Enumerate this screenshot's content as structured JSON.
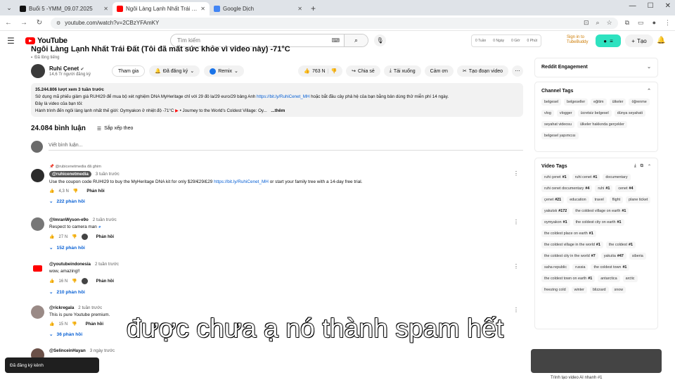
{
  "browser": {
    "tabs": [
      {
        "title": "Buổi 5 -YMM_09.07.2025",
        "favicon": "#111111"
      },
      {
        "title": "Ngôi Làng Lạnh Nhất Trái Đ...",
        "favicon": "#ff0000"
      },
      {
        "title": "Google Dịch",
        "favicon": "#4285f4"
      }
    ],
    "url": "youtube.com/watch?v=2CBzYFAmKY"
  },
  "header": {
    "logo": "YouTube",
    "search_placeholder": "Tìm kiếm",
    "extension": {
      "stats": [
        "0 Tuần",
        "0 Ngày",
        "0 Giờ",
        "0 Phút"
      ]
    },
    "tubebuddy": [
      "Sign in to",
      "TubeBuddy"
    ],
    "create_label": "Tạo"
  },
  "video": {
    "title": "Ngôi Làng Lạnh Nhất Trái Đất (Tôi đã mất sức khỏe vì video này) -71°C",
    "dubbed": "Đã lồng tiếng",
    "channel": {
      "name": "Ruhi Çenet",
      "subs": "14,6 Tr người đăng ký"
    },
    "buttons": {
      "join": "Tham gia",
      "subscribed": "Đã đăng ký",
      "remix": "Remix",
      "likes": "763 N",
      "share": "Chia sẻ",
      "download": "Tải xuống",
      "thanks": "Cảm ơn",
      "clip": "Tạo đoạn video"
    },
    "description": {
      "stats": "35.244.806 lượt xem  3 tuần trước",
      "line1": "Sử dụng mã phiếu giảm giá RUHI29 để mua bộ xét nghiệm DNA MyHeritage chỉ với 29 đô la/29 euro/29 bảng Anh",
      "link": "https://bit.ly/RuhiCenet_MH",
      "line1b": "hoặc bắt đầu cây phả hệ của bạn bằng bản dùng thử miễn phí 14 ngày.",
      "line2": "Đây là video của bạn tôi:",
      "line3": "Hành trình đến ngôi làng lạnh nhất thế giới: Oymyakon ở nhiệt độ -71°C",
      "line3b": "• Journey to the World's Coldest Village: Oy...",
      "more": "...thêm"
    }
  },
  "comments": {
    "count": "24.084 bình luận",
    "sort": "Sắp xếp theo",
    "placeholder": "Viết bình luận...",
    "items": [
      {
        "pinned": "@rubicenetmedia đã ghim",
        "author": "@ruhicenetmedia",
        "time": "3 tuần trước",
        "text": "Use the coupon code RUHI29 to buy the MyHeritage DNA kit for only $29/€29/£29",
        "link": "https://bit.ly/RuhiCenet_MH",
        "text_after": "or start your family tree with a 14-day free trial.",
        "likes": "4,3 N",
        "reply": "Phản hồi",
        "replies": "222 phản hồi",
        "avatar": "#2b2b2b"
      },
      {
        "author": "@ImranWyson-e9o",
        "time": "2 tuần trước",
        "text": "Respect to camera man",
        "likes": "27 N",
        "reply": "Phản hồi",
        "replies": "152 phản hồi",
        "avatar": "#777777"
      },
      {
        "author": "@youtubeindonesia",
        "time": "2 tuần trước",
        "text": "wow, amazing!!",
        "likes": "16 N",
        "reply": "Phản hồi",
        "replies": "210 phản hồi",
        "avatar": "#ff0000"
      },
      {
        "author": "@rickregala",
        "time": "2 tuần trước",
        "text": "This is pure Youtube premium.",
        "likes": "15 N",
        "reply": "Phản hồi",
        "replies": "36 phản hồi",
        "avatar": "#9a8a86"
      },
      {
        "author": "@SelinceinHayan",
        "time": "3 ngày trước",
        "text": "",
        "avatar": "#6a5048"
      }
    ]
  },
  "sidebar": {
    "reddit": "Reddit Engagement",
    "channel_tags_title": "Channel Tags",
    "channel_tags": [
      "belgesel",
      "belgeseller",
      "eğitim",
      "ülkeler",
      "öğrenme",
      "vlog",
      "vlogger",
      "ücretsiz belgesel",
      "dünya seyahati",
      "seyahat videosu",
      "ülkeler hakkında gerçekler",
      "belgesel yapımcısı"
    ],
    "video_tags_title": "Video Tags",
    "video_tags": [
      {
        "t": "ruhi çenet",
        "n": "#1"
      },
      {
        "t": "ruhi cenet",
        "n": "#1"
      },
      {
        "t": "documentary",
        "n": ""
      },
      {
        "t": "ruhi cenet documentary",
        "n": "#4"
      },
      {
        "t": "ruhi",
        "n": "#1"
      },
      {
        "t": "cenet",
        "n": "#4"
      },
      {
        "t": "çenet",
        "n": "#21"
      },
      {
        "t": "education",
        "n": ""
      },
      {
        "t": "travel",
        "n": ""
      },
      {
        "t": "flight",
        "n": ""
      },
      {
        "t": "plane ticket",
        "n": ""
      },
      {
        "t": "yakutsk",
        "n": "#172"
      },
      {
        "t": "the coldest village on earth",
        "n": "#1"
      },
      {
        "t": "oymyakon",
        "n": "#1"
      },
      {
        "t": "the coldest city on earth",
        "n": "#1"
      },
      {
        "t": "the coldest place on earth",
        "n": "#1"
      },
      {
        "t": "the coldest village in the world",
        "n": "#1"
      },
      {
        "t": "the coldest",
        "n": "#1"
      },
      {
        "t": "the coldest city in the world",
        "n": "#7"
      },
      {
        "t": "yakutia",
        "n": "#47"
      },
      {
        "t": "siberia",
        "n": ""
      },
      {
        "t": "saha republic",
        "n": ""
      },
      {
        "t": "russia",
        "n": ""
      },
      {
        "t": "the coldest town",
        "n": "#1"
      },
      {
        "t": "the coldest town on earth",
        "n": "#1"
      },
      {
        "t": "antarctica",
        "n": ""
      },
      {
        "t": "arctic",
        "n": ""
      },
      {
        "t": "freezing cold",
        "n": ""
      },
      {
        "t": "winter",
        "n": ""
      },
      {
        "t": "blizzard",
        "n": ""
      },
      {
        "t": "snow",
        "n": ""
      }
    ],
    "thumb_label": "Trình tạo video AI nhanh #1"
  },
  "overlay": {
    "subtitle": "được chưa ạ nó thành spam hết",
    "toast": "Đã đăng ký kênh"
  }
}
